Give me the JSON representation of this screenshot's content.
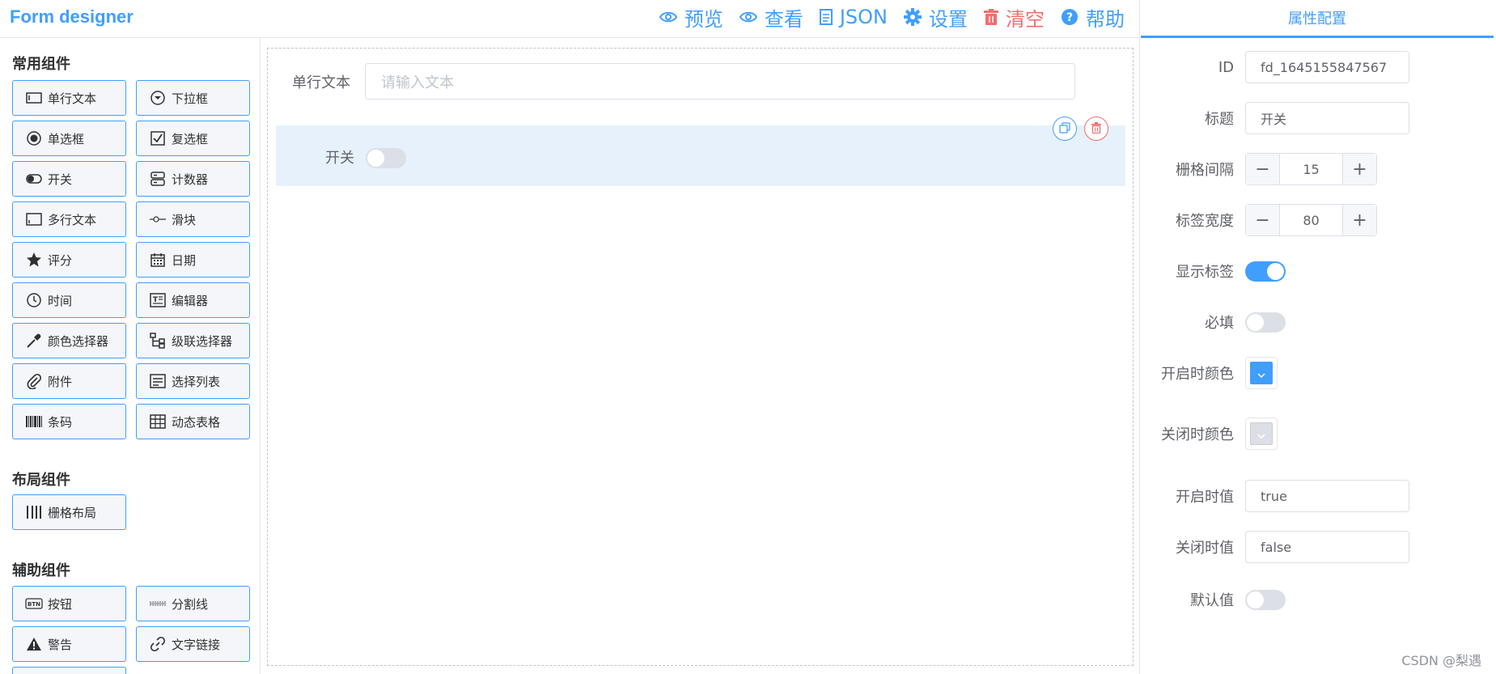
{
  "app": {
    "title": "Form designer"
  },
  "toolbar": {
    "items": [
      {
        "label": "预览",
        "icon": "eye-icon"
      },
      {
        "label": "查看",
        "icon": "eye-icon"
      },
      {
        "label": "JSON",
        "icon": "document-icon"
      },
      {
        "label": "设置",
        "icon": "gear-icon"
      },
      {
        "label": "清空",
        "icon": "trash-icon"
      },
      {
        "label": "帮助",
        "icon": "help-icon"
      }
    ]
  },
  "components": {
    "common": {
      "title": "常用组件",
      "items": [
        {
          "label": "单行文本",
          "icon": "input-icon"
        },
        {
          "label": "下拉框",
          "icon": "select-icon"
        },
        {
          "label": "单选框",
          "icon": "radio-icon"
        },
        {
          "label": "复选框",
          "icon": "checkbox-icon"
        },
        {
          "label": "开关",
          "icon": "switch-icon"
        },
        {
          "label": "计数器",
          "icon": "counter-icon"
        },
        {
          "label": "多行文本",
          "icon": "textarea-icon"
        },
        {
          "label": "滑块",
          "icon": "slider-icon"
        },
        {
          "label": "评分",
          "icon": "star-icon"
        },
        {
          "label": "日期",
          "icon": "calendar-icon"
        },
        {
          "label": "时间",
          "icon": "clock-icon"
        },
        {
          "label": "编辑器",
          "icon": "editor-icon"
        },
        {
          "label": "颜色选择器",
          "icon": "color-picker-icon"
        },
        {
          "label": "级联选择器",
          "icon": "cascader-icon"
        },
        {
          "label": "附件",
          "icon": "attachment-icon"
        },
        {
          "label": "选择列表",
          "icon": "list-icon"
        },
        {
          "label": "条码",
          "icon": "barcode-icon"
        },
        {
          "label": "动态表格",
          "icon": "table-icon"
        }
      ]
    },
    "layout": {
      "title": "布局组件",
      "items": [
        {
          "label": "栅格布局",
          "icon": "grid-icon"
        }
      ]
    },
    "auxiliary": {
      "title": "辅助组件",
      "items": [
        {
          "label": "按钮",
          "icon": "button-icon"
        },
        {
          "label": "分割线",
          "icon": "divider-icon"
        },
        {
          "label": "警告",
          "icon": "alert-icon"
        },
        {
          "label": "文字链接",
          "icon": "link-icon"
        }
      ]
    }
  },
  "canvas": {
    "text_field": {
      "label": "单行文本",
      "placeholder": "请输入文本"
    },
    "switch_field": {
      "label": "开关",
      "value": false
    }
  },
  "properties": {
    "tab": "属性配置",
    "rows": [
      {
        "label": "ID",
        "type": "input",
        "value": "fd_1645155847567"
      },
      {
        "label": "标题",
        "type": "input",
        "value": "开关"
      },
      {
        "label": "栅格间隔",
        "type": "stepper",
        "value": "15"
      },
      {
        "label": "标签宽度",
        "type": "stepper",
        "value": "80"
      },
      {
        "label": "显示标签",
        "type": "switch",
        "value": true
      },
      {
        "label": "必填",
        "type": "switch",
        "value": false
      },
      {
        "label": "开启时颜色",
        "type": "color",
        "value": "#409eff"
      },
      {
        "label": "关闭时颜色",
        "type": "color",
        "value": "#dcdfe6"
      },
      {
        "label": "开启时值",
        "type": "input",
        "value": "true"
      },
      {
        "label": "关闭时值",
        "type": "input",
        "value": "false"
      },
      {
        "label": "默认值",
        "type": "switch",
        "value": false
      }
    ]
  },
  "watermark": "CSDN @梨遇",
  "colors": {
    "primary": "#409eff",
    "danger": "#f56c6c",
    "switch_off": "#dcdfe6"
  }
}
